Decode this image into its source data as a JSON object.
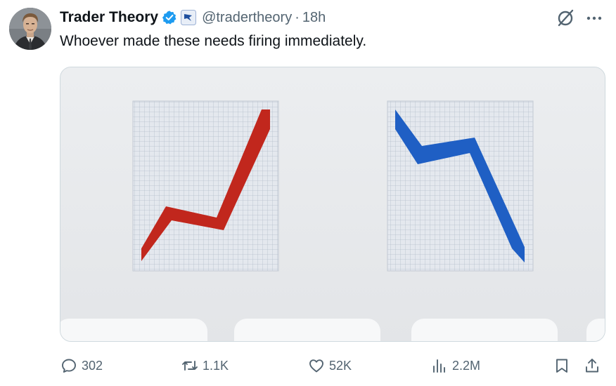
{
  "tweet": {
    "author": {
      "display_name": "Trader Theory",
      "handle": "@tradertheory",
      "verified": true,
      "affiliate_badge": "bird-badge-icon"
    },
    "separator": "·",
    "time": "18h",
    "text": "Whoever made these needs firing immediately.",
    "media": {
      "left_chart": {
        "color": "#c1271d",
        "trend": "up"
      },
      "right_chart": {
        "color": "#1f5fc4",
        "trend": "down"
      }
    },
    "stats": {
      "replies": "302",
      "reposts": "1.1K",
      "likes": "52K",
      "views": "2.2M"
    }
  },
  "colors": {
    "text_primary": "#0f1419",
    "text_secondary": "#536471",
    "verified_blue": "#1d9bf0",
    "border": "#cfd9de"
  },
  "icons": [
    "grok-icon",
    "more-icon",
    "reply-icon",
    "retweet-icon",
    "like-icon",
    "views-icon",
    "bookmark-icon",
    "share-icon"
  ]
}
